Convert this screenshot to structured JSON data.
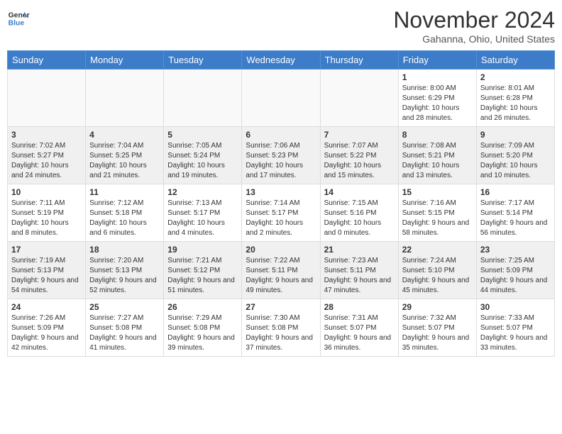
{
  "header": {
    "logo_line1": "General",
    "logo_line2": "Blue",
    "month": "November 2024",
    "location": "Gahanna, Ohio, United States"
  },
  "weekdays": [
    "Sunday",
    "Monday",
    "Tuesday",
    "Wednesday",
    "Thursday",
    "Friday",
    "Saturday"
  ],
  "weeks": [
    [
      {
        "day": "",
        "info": ""
      },
      {
        "day": "",
        "info": ""
      },
      {
        "day": "",
        "info": ""
      },
      {
        "day": "",
        "info": ""
      },
      {
        "day": "",
        "info": ""
      },
      {
        "day": "1",
        "info": "Sunrise: 8:00 AM\nSunset: 6:29 PM\nDaylight: 10 hours and 28 minutes."
      },
      {
        "day": "2",
        "info": "Sunrise: 8:01 AM\nSunset: 6:28 PM\nDaylight: 10 hours and 26 minutes."
      }
    ],
    [
      {
        "day": "3",
        "info": "Sunrise: 7:02 AM\nSunset: 5:27 PM\nDaylight: 10 hours and 24 minutes."
      },
      {
        "day": "4",
        "info": "Sunrise: 7:04 AM\nSunset: 5:25 PM\nDaylight: 10 hours and 21 minutes."
      },
      {
        "day": "5",
        "info": "Sunrise: 7:05 AM\nSunset: 5:24 PM\nDaylight: 10 hours and 19 minutes."
      },
      {
        "day": "6",
        "info": "Sunrise: 7:06 AM\nSunset: 5:23 PM\nDaylight: 10 hours and 17 minutes."
      },
      {
        "day": "7",
        "info": "Sunrise: 7:07 AM\nSunset: 5:22 PM\nDaylight: 10 hours and 15 minutes."
      },
      {
        "day": "8",
        "info": "Sunrise: 7:08 AM\nSunset: 5:21 PM\nDaylight: 10 hours and 13 minutes."
      },
      {
        "day": "9",
        "info": "Sunrise: 7:09 AM\nSunset: 5:20 PM\nDaylight: 10 hours and 10 minutes."
      }
    ],
    [
      {
        "day": "10",
        "info": "Sunrise: 7:11 AM\nSunset: 5:19 PM\nDaylight: 10 hours and 8 minutes."
      },
      {
        "day": "11",
        "info": "Sunrise: 7:12 AM\nSunset: 5:18 PM\nDaylight: 10 hours and 6 minutes."
      },
      {
        "day": "12",
        "info": "Sunrise: 7:13 AM\nSunset: 5:17 PM\nDaylight: 10 hours and 4 minutes."
      },
      {
        "day": "13",
        "info": "Sunrise: 7:14 AM\nSunset: 5:17 PM\nDaylight: 10 hours and 2 minutes."
      },
      {
        "day": "14",
        "info": "Sunrise: 7:15 AM\nSunset: 5:16 PM\nDaylight: 10 hours and 0 minutes."
      },
      {
        "day": "15",
        "info": "Sunrise: 7:16 AM\nSunset: 5:15 PM\nDaylight: 9 hours and 58 minutes."
      },
      {
        "day": "16",
        "info": "Sunrise: 7:17 AM\nSunset: 5:14 PM\nDaylight: 9 hours and 56 minutes."
      }
    ],
    [
      {
        "day": "17",
        "info": "Sunrise: 7:19 AM\nSunset: 5:13 PM\nDaylight: 9 hours and 54 minutes."
      },
      {
        "day": "18",
        "info": "Sunrise: 7:20 AM\nSunset: 5:13 PM\nDaylight: 9 hours and 52 minutes."
      },
      {
        "day": "19",
        "info": "Sunrise: 7:21 AM\nSunset: 5:12 PM\nDaylight: 9 hours and 51 minutes."
      },
      {
        "day": "20",
        "info": "Sunrise: 7:22 AM\nSunset: 5:11 PM\nDaylight: 9 hours and 49 minutes."
      },
      {
        "day": "21",
        "info": "Sunrise: 7:23 AM\nSunset: 5:11 PM\nDaylight: 9 hours and 47 minutes."
      },
      {
        "day": "22",
        "info": "Sunrise: 7:24 AM\nSunset: 5:10 PM\nDaylight: 9 hours and 45 minutes."
      },
      {
        "day": "23",
        "info": "Sunrise: 7:25 AM\nSunset: 5:09 PM\nDaylight: 9 hours and 44 minutes."
      }
    ],
    [
      {
        "day": "24",
        "info": "Sunrise: 7:26 AM\nSunset: 5:09 PM\nDaylight: 9 hours and 42 minutes."
      },
      {
        "day": "25",
        "info": "Sunrise: 7:27 AM\nSunset: 5:08 PM\nDaylight: 9 hours and 41 minutes."
      },
      {
        "day": "26",
        "info": "Sunrise: 7:29 AM\nSunset: 5:08 PM\nDaylight: 9 hours and 39 minutes."
      },
      {
        "day": "27",
        "info": "Sunrise: 7:30 AM\nSunset: 5:08 PM\nDaylight: 9 hours and 37 minutes."
      },
      {
        "day": "28",
        "info": "Sunrise: 7:31 AM\nSunset: 5:07 PM\nDaylight: 9 hours and 36 minutes."
      },
      {
        "day": "29",
        "info": "Sunrise: 7:32 AM\nSunset: 5:07 PM\nDaylight: 9 hours and 35 minutes."
      },
      {
        "day": "30",
        "info": "Sunrise: 7:33 AM\nSunset: 5:07 PM\nDaylight: 9 hours and 33 minutes."
      }
    ]
  ]
}
